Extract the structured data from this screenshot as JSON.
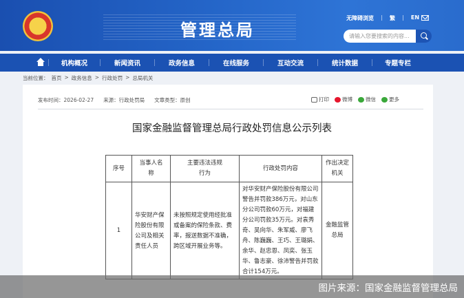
{
  "header": {
    "site_title": "管理总局",
    "top_links": [
      "无障碍浏览",
      "繁",
      "EN"
    ],
    "search_placeholder": "请输入您要搜索的内容..."
  },
  "nav": {
    "items": [
      "机构概况",
      "新闻资讯",
      "政务信息",
      "在线服务",
      "互动交流",
      "统计数据",
      "专题专栏"
    ]
  },
  "breadcrumb": {
    "prefix": "当前位置：",
    "items": [
      "首页",
      "政务信息",
      "行政处罚",
      "总局机关"
    ]
  },
  "meta": {
    "date": "发布时间：2026-02-27",
    "source": "来源：行政处罚局",
    "type": "文章类型：原创"
  },
  "share": {
    "print": "打印",
    "weibo": "微博",
    "wechat": "微信",
    "more": "更多"
  },
  "article": {
    "title": "国家金融监督管理总局行政处罚信息公示列表"
  },
  "table": {
    "headers": [
      "序号",
      "当事人名称",
      "主要违法违规行为",
      "行政处罚内容",
      "作出决定机关"
    ],
    "rows": [
      {
        "no": "1",
        "party": "华安财产保险股份有限公司及相关责任人员",
        "violation": "未按照规定使用经批准或备案的保险条款、费率，报送数据不准确，跨区域开展业务等。",
        "penalty": "对华安财产保险股份有限公司警告并罚款386万元，对山东分公司罚款60万元，对福建分公司罚款35万元。对袁秀奇、吴向华、朱军威、廖飞舟、陈巍巍、王巧、王璐娟、余华、赵忠恩、凤奕、张玉华、鲁志豪、徐沛警告并罚款合计154万元。",
        "authority": "金融监管总局"
      }
    ]
  },
  "caption": "图片来源：国家金融监督管理总局",
  "colors": {
    "header_blue": "#2465c8",
    "nav_blue": "#1b52b3"
  }
}
